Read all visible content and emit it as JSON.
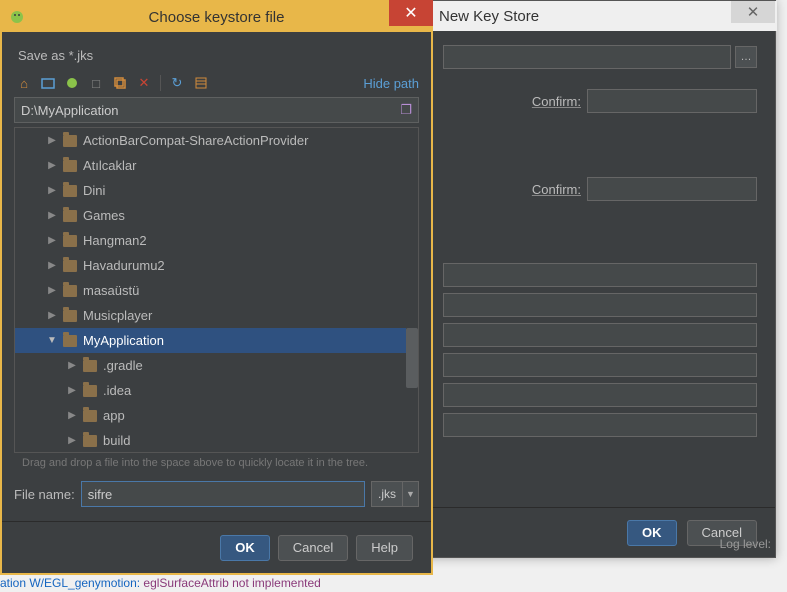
{
  "back_dialog": {
    "title": "New Key Store",
    "confirm_label": "Confirm:",
    "ok": "OK",
    "cancel": "Cancel",
    "log_label": "Log level:"
  },
  "front_dialog": {
    "title": "Choose keystore file",
    "save_as": "Save as *.jks",
    "hide_path": "Hide path",
    "path_value": "D:\\MyApplication",
    "tree": {
      "hint": "Drag and drop a file into the space above to quickly locate it in the tree.",
      "items": [
        {
          "indent": 1,
          "open": false,
          "label": "ActionBarCompat-ShareActionProvider"
        },
        {
          "indent": 1,
          "open": false,
          "label": "Atılcaklar"
        },
        {
          "indent": 1,
          "open": false,
          "label": "Dini"
        },
        {
          "indent": 1,
          "open": false,
          "label": "Games"
        },
        {
          "indent": 1,
          "open": false,
          "label": "Hangman2"
        },
        {
          "indent": 1,
          "open": false,
          "label": "Havadurumu2"
        },
        {
          "indent": 1,
          "open": false,
          "label": "masaüstü"
        },
        {
          "indent": 1,
          "open": false,
          "label": "Musicplayer"
        },
        {
          "indent": 1,
          "open": true,
          "label": "MyApplication",
          "selected": true
        },
        {
          "indent": 2,
          "open": false,
          "label": ".gradle"
        },
        {
          "indent": 2,
          "open": false,
          "label": ".idea"
        },
        {
          "indent": 2,
          "open": false,
          "label": "app"
        },
        {
          "indent": 2,
          "open": false,
          "label": "build"
        }
      ]
    },
    "filename_label": "File name:",
    "filename_value": "sifre",
    "ext_label": ".jks",
    "ok": "OK",
    "cancel": "Cancel",
    "help": "Help"
  },
  "console": {
    "tag": "ation W/EGL_genymotion:",
    "msg": "  eglSurfaceAttrib not implemented"
  },
  "icons": {
    "close": "✕",
    "home": "⌂",
    "folder_new": "□",
    "delete": "✕",
    "refresh": "↻",
    "browse": "…",
    "dropdown": "▼",
    "history": "❐"
  }
}
